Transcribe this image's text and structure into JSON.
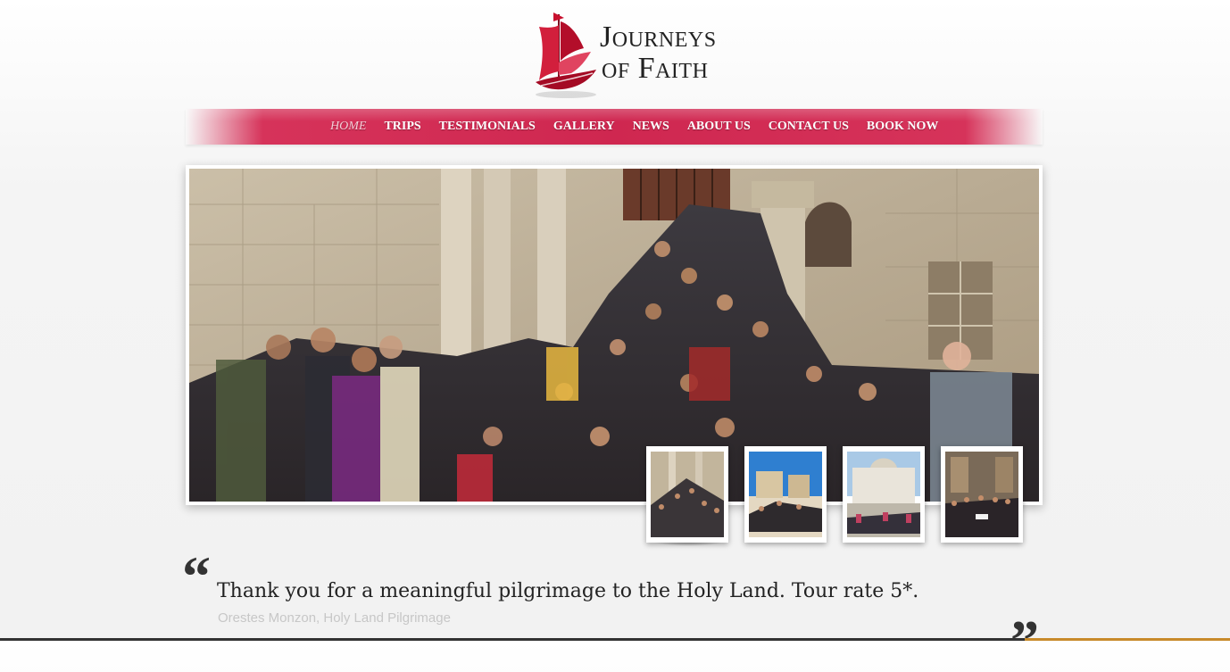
{
  "logo": {
    "line1": "Journeys",
    "line2": "of Faith"
  },
  "nav": {
    "items": [
      {
        "label": "HOME",
        "active": true
      },
      {
        "label": "TRIPS"
      },
      {
        "label": "TESTIMONIALS"
      },
      {
        "label": "GALLERY"
      },
      {
        "label": "NEWS"
      },
      {
        "label": "ABOUT US"
      },
      {
        "label": "CONTACT US"
      },
      {
        "label": "BOOK NOW"
      }
    ]
  },
  "testimonial": {
    "text": "Thank you for a meaningful pilgrimage to the Holy Land. Tour rate 5*.",
    "author": "Orestes Monzon, Holy Land Pilgrimage"
  },
  "colors": {
    "nav_red": "#cf2750",
    "logo_red": "#c8102e",
    "text_dark": "#222222",
    "author_grey": "#c7c7c7"
  }
}
